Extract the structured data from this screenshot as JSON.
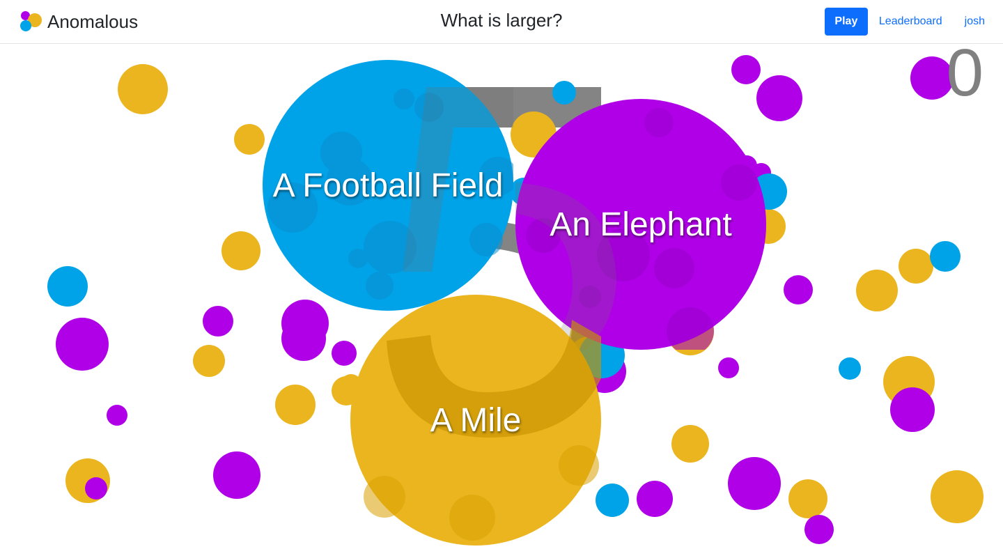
{
  "app": {
    "name": "Anomalous",
    "title": "What is larger?"
  },
  "nav": {
    "play_label": "Play",
    "leaderboard_label": "Leaderboard",
    "user_label": "josh"
  },
  "game": {
    "score": "0",
    "choices": [
      {
        "label": "A Football Field",
        "color": "#00a2e8"
      },
      {
        "label": "An Elephant",
        "color": "#b000e8"
      },
      {
        "label": "A Mile",
        "color": "#ebb51f"
      }
    ]
  },
  "colors": {
    "blue": "#00a2e8",
    "purple": "#b000e8",
    "gold": "#ebb51f",
    "primary": "#0d6efd",
    "score_gray": "#808080"
  }
}
